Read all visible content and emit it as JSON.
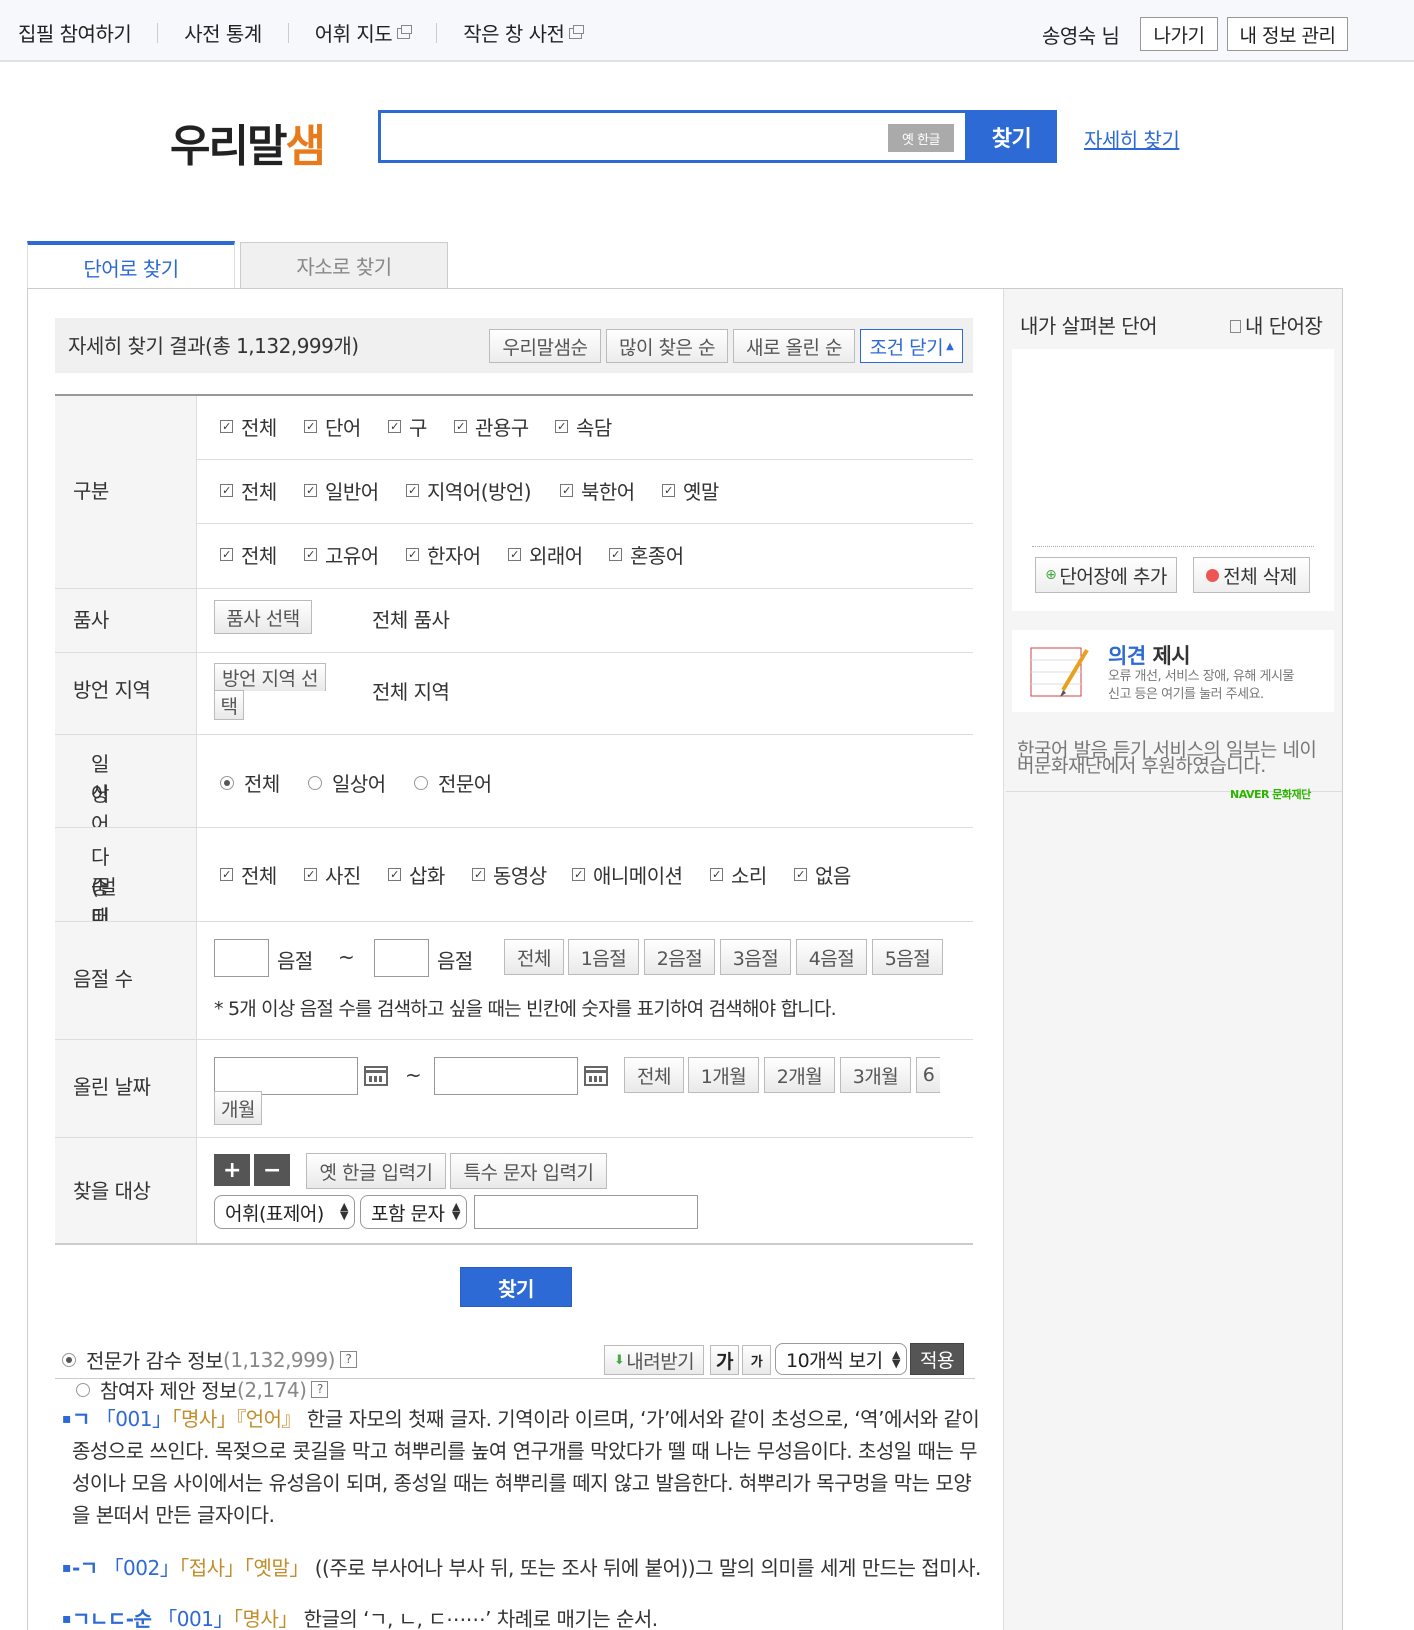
{
  "topbar": {
    "nav": [
      {
        "label": "집필 참여하기",
        "popup": false
      },
      {
        "label": "사전 통계",
        "popup": false
      },
      {
        "label": "어휘 지도",
        "popup": true
      },
      {
        "label": "작은 창 사전",
        "popup": true
      }
    ],
    "user": "송영숙 님",
    "logout": "나가기",
    "myinfo": "내 정보 관리"
  },
  "logo": {
    "part1": "우리말",
    "part2": "샘"
  },
  "search": {
    "value": "",
    "old_hangul": "옛 한글",
    "button": "찾기",
    "advanced": "자세히 찾기"
  },
  "tabs": {
    "word": "단어로 찾기",
    "morpheme": "자소로 찾기"
  },
  "results": {
    "title": "자세히 찾기 결과(총 1,132,999개)",
    "sort": [
      "우리말샘순",
      "많이 찾은 순",
      "새로 올린 순"
    ],
    "close_conditions": "조건 닫기"
  },
  "form": {
    "category": {
      "label": "구분",
      "row1": [
        "전체",
        "단어",
        "구",
        "관용구",
        "속담"
      ],
      "row2": [
        "전체",
        "일반어",
        "지역어(방언)",
        "북한어",
        "옛말"
      ],
      "row3": [
        "전체",
        "고유어",
        "한자어",
        "외래어",
        "혼종어"
      ]
    },
    "pos": {
      "label": "품사",
      "button": "품사 선택",
      "value": "전체 품사"
    },
    "dialect": {
      "label": "방언 지역",
      "button_line1": "방언 지역 선",
      "button_line2": "택",
      "value": "전체 지역"
    },
    "daily": {
      "label_line1": "일상어 · 전문",
      "label_line2": "어",
      "options": [
        "전체",
        "일상어",
        "전문어"
      ],
      "selected": "전체"
    },
    "media": {
      "label_line1": "다중 매체",
      "label_line2": "(멀티미디어)",
      "options": [
        "전체",
        "사진",
        "삽화",
        "동영상",
        "애니메이션",
        "소리",
        "없음"
      ]
    },
    "syllable": {
      "label": "음절 수",
      "unit": "음절",
      "tilde": "~",
      "buttons": [
        "전체",
        "1음절",
        "2음절",
        "3음절",
        "4음절",
        "5음절"
      ],
      "note": "* 5개 이상 음절 수를 검색하고 싶을 때는 빈칸에 숫자를 표기하여 검색해야 합니다."
    },
    "date": {
      "label": "올린 날짜",
      "tilde": "~",
      "buttons": [
        "전체",
        "1개월",
        "2개월",
        "3개월"
      ],
      "six_line1": "6",
      "six_line2": "개월"
    },
    "target": {
      "label": "찾을 대상",
      "plus": "+",
      "minus": "−",
      "old_input": "옛 한글 입력기",
      "special_input": "특수 문자 입력기",
      "select1": "어휘(표제어)",
      "select2": "포함 문자",
      "value": ""
    },
    "submit": "찾기"
  },
  "list": {
    "expert": {
      "label": "전문가 감수 정보",
      "count": "(1,132,999)",
      "help": "?"
    },
    "participant": {
      "label": "참여자 제안 정보",
      "count": "(2,174)",
      "help": "?"
    },
    "download": "내려받기",
    "font_large": "가",
    "font_small": "가",
    "per_page": "10개씩 보기",
    "apply": "적용"
  },
  "entries": [
    {
      "headword": "ㄱ",
      "number": "「001」",
      "tags": "「명사」『언어』",
      "definition": "한글 자모의 첫째 글자. 기역이라 이르며, ‘가’에서와 같이 초성으로, ‘역’에서와 같이 종성으로 쓰인다. 목젖으로 콧길을 막고 혀뿌리를 높여 연구개를 막았다가 뗄 때 나는 무성음이다. 초성일 때는 무성이나 모음 사이에서는 유성음이 되며, 종성일 때는 혀뿌리를 떼지 않고 발음한다. 혀뿌리가 목구멍을 막는 모양을 본떠서 만든 글자이다."
    },
    {
      "headword": "-ㄱ",
      "number": "「002」",
      "tags": "「접사」「옛말」",
      "definition": "((주로 부사어나 부사 뒤, 또는 조사 뒤에 붙어))그 말의 의미를 세게 만드는 접미사."
    },
    {
      "headword": "ㄱㄴㄷ-순",
      "number": "「001」",
      "tags": "「명사」",
      "definition": "한글의 ‘ㄱ, ㄴ, ㄷ⋯⋯’ 차례로 매기는 순서."
    }
  ],
  "sidebar": {
    "recent_title": "내가 살펴본 단어",
    "my_words": "내 단어장",
    "add": "단어장에 추가",
    "delete_all": "전체 삭제",
    "opinion_title_a": "의견",
    "opinion_title_b": "제시",
    "opinion_line1": "오류 개선, 서비스 장애, 유해 게시물",
    "opinion_line2": "신고 등은 여기를 눌러 주세요.",
    "sponsor_line1": "한국어 발음 듣기 서비스의 일부는 네이",
    "sponsor_line2": "버문화재단에서 후원하였습니다.",
    "naver": "NAVER 문화재단"
  },
  "colors": {
    "accent": "#2e6ad6",
    "logo_accent": "#e87a1c",
    "tag": "#c08e2c",
    "naver": "#2db400"
  }
}
